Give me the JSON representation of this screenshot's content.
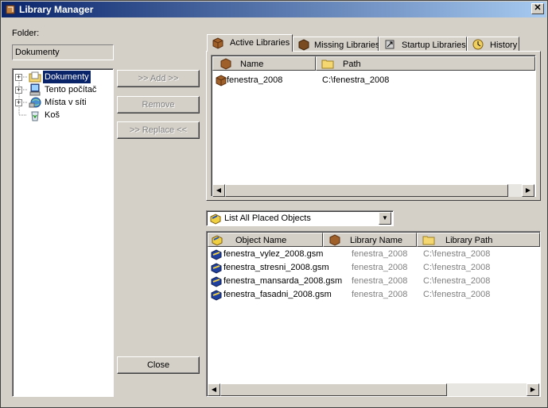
{
  "window": {
    "title": "Library Manager",
    "close_glyph": "✕"
  },
  "folder": {
    "label": "Folder:",
    "value": "Dokumenty",
    "tree": [
      {
        "label": "Dokumenty",
        "icon": "folder-documents-icon",
        "expandable": true,
        "selected": true
      },
      {
        "label": "Tento počítač",
        "icon": "my-computer-icon",
        "expandable": true
      },
      {
        "label": "Místa v síti",
        "icon": "network-places-icon",
        "expandable": true
      },
      {
        "label": "Koš",
        "icon": "recycle-bin-icon",
        "expandable": false
      }
    ]
  },
  "actions": {
    "add": ">> Add >>",
    "remove": "Remove",
    "replace": ">> Replace <<",
    "close": "Close"
  },
  "tabs": [
    {
      "label": "Active Libraries",
      "icon": "library-box-icon",
      "active": true
    },
    {
      "label": "Missing Libraries",
      "icon": "missing-library-icon"
    },
    {
      "label": "Startup Libraries",
      "icon": "startup-library-icon"
    },
    {
      "label": "History",
      "icon": "history-icon"
    }
  ],
  "libraries": {
    "columns": {
      "name": "Name",
      "path": "Path"
    },
    "rows": [
      {
        "name": "fenestra_2008",
        "path": "C:\\fenestra_2008"
      }
    ]
  },
  "filter": {
    "selected": "List All Placed Objects",
    "icon": "placed-objects-icon"
  },
  "objects": {
    "columns": {
      "object_name": "Object Name",
      "library_name": "Library Name",
      "library_path": "Library Path"
    },
    "rows": [
      {
        "object_name": "fenestra_vylez_2008.gsm",
        "library_name": "fenestra_2008",
        "library_path": "C:\\fenestra_2008"
      },
      {
        "object_name": "fenestra_stresni_2008.gsm",
        "library_name": "fenestra_2008",
        "library_path": "C:\\fenestra_2008"
      },
      {
        "object_name": "fenestra_mansarda_2008.gsm",
        "library_name": "fenestra_2008",
        "library_path": "C:\\fenestra_2008"
      },
      {
        "object_name": "fenestra_fasadni_2008.gsm",
        "library_name": "fenestra_2008",
        "library_path": "C:\\fenestra_2008"
      }
    ]
  },
  "colors": {
    "title_start": "#0a246a",
    "title_end": "#a6caf0",
    "face": "#d4d0c8",
    "selection": "#0a246a"
  }
}
